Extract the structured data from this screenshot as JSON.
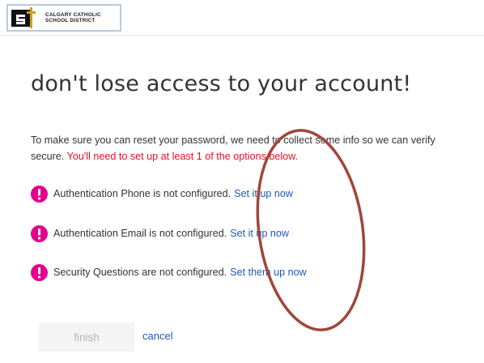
{
  "header": {
    "logo_line1": "CALGARY CATHOLIC",
    "logo_line2": "SCHOOL DISTRICT"
  },
  "page": {
    "title": "don't lose access to your account!",
    "intro_line1": "To make sure you can reset your password, we need to collect some info so we can verify",
    "intro_line2": "secure. ",
    "intro_warning": "You'll need to set up at least 1 of the options below."
  },
  "methods": [
    {
      "status": "Authentication Phone is not configured.",
      "action": "Set it up now"
    },
    {
      "status": "Authentication Email is not configured.",
      "action": "Set it up now"
    },
    {
      "status": "Security Questions are not configured.",
      "action": "Set them up now"
    }
  ],
  "actions": {
    "finish_label": "finish",
    "cancel_label": "cancel"
  },
  "colors": {
    "alert": "#e3008c",
    "link": "#2058bb",
    "warning_text": "#e81123",
    "annotation_ring": "#a2453a"
  },
  "icons": {
    "alert": "exclamation-circle-icon",
    "logo": "district-logo-mark"
  }
}
